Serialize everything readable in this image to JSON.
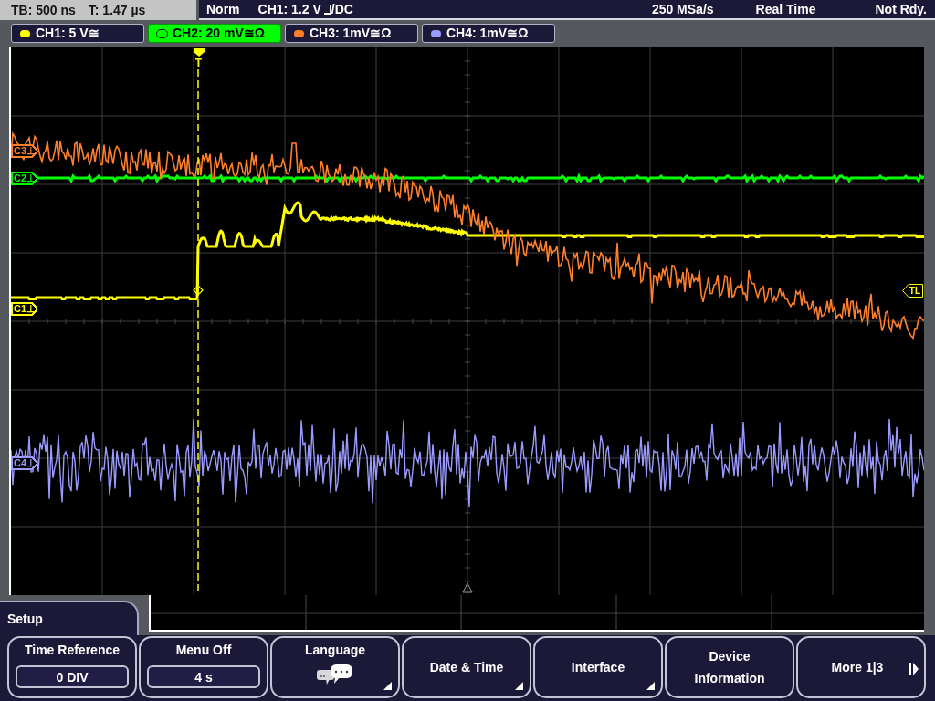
{
  "status_bar": {
    "timebase": "TB: 500 ns",
    "trigger_time": "T: 1.47 µs",
    "trigger_mode": "Norm",
    "trigger_source": "CH1: 1.2 V",
    "trigger_coupling": "/DC",
    "sample_rate": "250 MSa/s",
    "acquisition_mode": "Real Time",
    "acquisition_state": "Not Rdy."
  },
  "channels": [
    {
      "label": "CH1: 5 V≅",
      "color": "#ffff00",
      "selected": false
    },
    {
      "label": "CH2: 20 mV≅Ω",
      "color": "#00ff00",
      "selected": true
    },
    {
      "label": "CH3: 1mV≅Ω",
      "color": "#ff7f2a",
      "selected": false
    },
    {
      "label": "CH4: 1mV≅Ω",
      "color": "#9a9aff",
      "selected": false
    }
  ],
  "graticule": {
    "trigger_marker": "T",
    "channel_markers": [
      {
        "label": "C3⊥",
        "color": "#ff7f2a"
      },
      {
        "label": "C2⊥",
        "color": "#00ff00"
      },
      {
        "label": "C1⊥",
        "color": "#ffff00"
      },
      {
        "label": "C4⊥",
        "color": "#9a9aff"
      }
    ],
    "trigger_level_marker": "TL"
  },
  "menu": {
    "title": "Setup",
    "buttons": [
      {
        "kind": "value",
        "label": "Time Reference",
        "value": "0 DIV",
        "submenu": false
      },
      {
        "kind": "value",
        "label": "Menu Off",
        "value": "4 s",
        "submenu": false
      },
      {
        "kind": "icon",
        "label": "Language",
        "submenu": true
      },
      {
        "kind": "text",
        "label": "Date & Time",
        "submenu": true
      },
      {
        "kind": "text",
        "label": "Interface",
        "submenu": true
      },
      {
        "kind": "text",
        "label": "Device Information",
        "submenu": false
      },
      {
        "kind": "next",
        "label": "More 1|3",
        "submenu": false
      }
    ]
  }
}
